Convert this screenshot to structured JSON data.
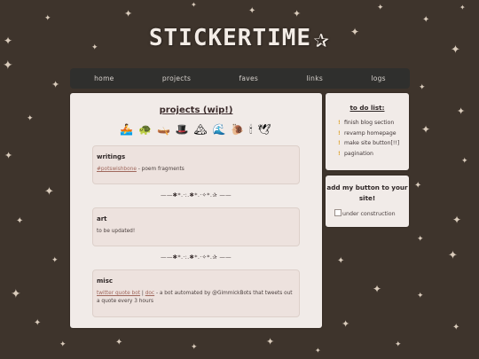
{
  "site": {
    "title": "STICKERTIME",
    "title_star": "✰"
  },
  "nav": {
    "items": [
      "home",
      "projects",
      "faves",
      "links",
      "logs"
    ]
  },
  "main": {
    "heading": "projects (wip!)",
    "icon_strip": [
      "🚣",
      "🐢",
      "🛶",
      "🎩",
      "🏔",
      "🌊",
      "🐌",
      "🕯",
      "🕊"
    ],
    "divider": "——✱*.·:.✱*.·✧*.✰ ——",
    "writings": {
      "title": "writings",
      "link": "#potswishbone",
      "text": " - poem fragments"
    },
    "art": {
      "title": "art",
      "text": "to be updated!"
    },
    "misc": {
      "title": "misc",
      "link1": "twitter quote bot",
      "sep": " | ",
      "link2": "doc",
      "text": " - a bot automated by @GimmickBots that tweets out a quote every 3 hours"
    }
  },
  "todo": {
    "title": "to do list:",
    "bullet": "!",
    "items": [
      "finish blog section",
      "revamp homepage",
      "make site button[!!]",
      "pagination"
    ]
  },
  "button_box": {
    "title": "add my button to your site!",
    "img_alt": "under construction"
  },
  "colors": {
    "background": "#3e342c",
    "nav": "#2f2f2d",
    "panel": "#f1ebe8",
    "card": "#ede2de",
    "link": "#a0685d",
    "bullet": "#e0a83c"
  }
}
